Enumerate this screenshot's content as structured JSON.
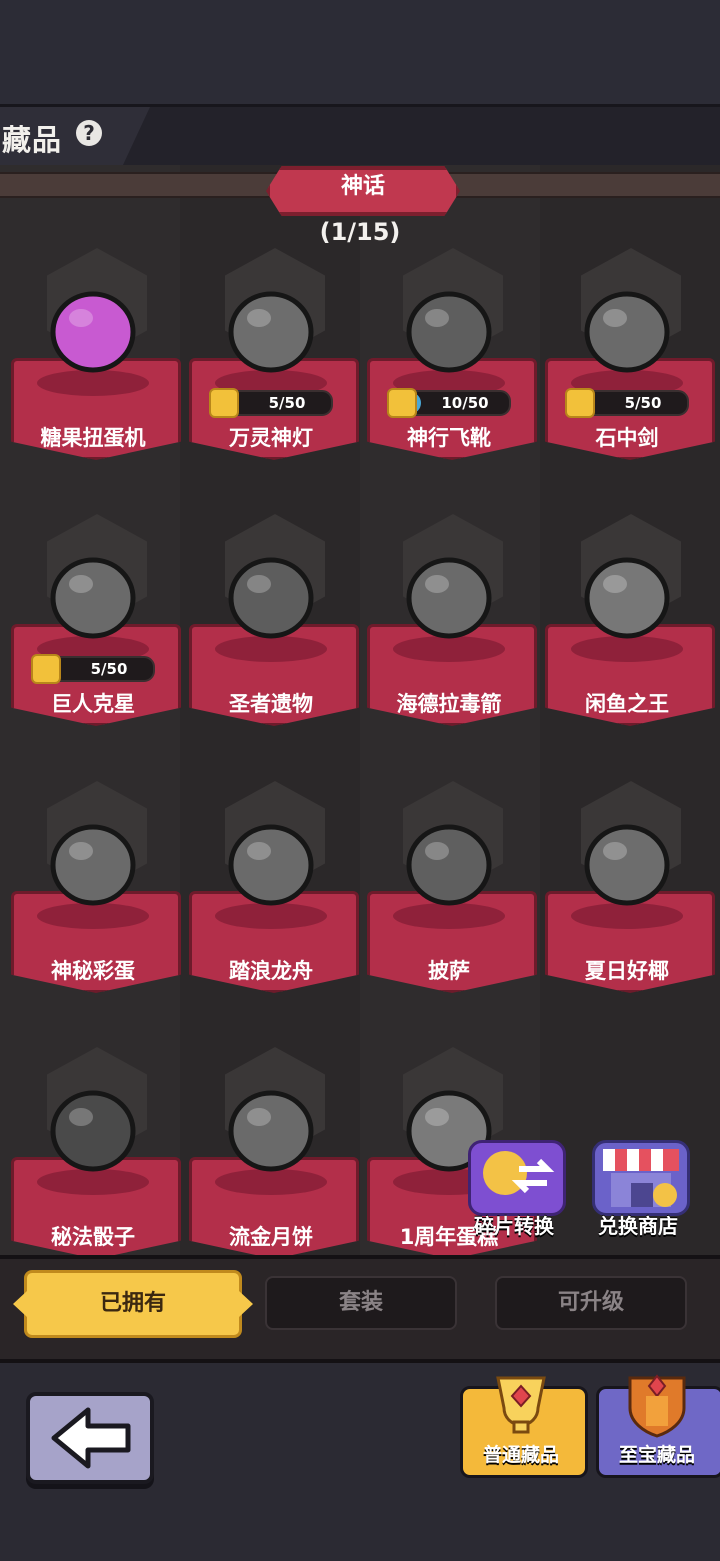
{
  "header": {
    "title": "藏品",
    "help_label": "?"
  },
  "category": {
    "name": "神话",
    "count": "(1/15)"
  },
  "items": [
    {
      "name": "糖果扭蛋机",
      "owned": true,
      "progress": null,
      "progress_fraction": null
    },
    {
      "name": "万灵神灯",
      "owned": false,
      "progress": "5/50",
      "progress_fraction": 0.1
    },
    {
      "name": "神行飞靴",
      "owned": false,
      "progress": "10/50",
      "progress_fraction": 0.2
    },
    {
      "name": "石中剑",
      "owned": false,
      "progress": "5/50",
      "progress_fraction": 0.1
    },
    {
      "name": "巨人克星",
      "owned": false,
      "progress": "5/50",
      "progress_fraction": 0.1
    },
    {
      "name": "圣者遗物",
      "owned": false,
      "progress": null,
      "progress_fraction": null
    },
    {
      "name": "海德拉毒箭",
      "owned": false,
      "progress": null,
      "progress_fraction": null
    },
    {
      "name": "闲鱼之王",
      "owned": false,
      "progress": null,
      "progress_fraction": null
    },
    {
      "name": "神秘彩蛋",
      "owned": false,
      "progress": null,
      "progress_fraction": null
    },
    {
      "name": "踏浪龙舟",
      "owned": false,
      "progress": null,
      "progress_fraction": null
    },
    {
      "name": "披萨",
      "owned": false,
      "progress": null,
      "progress_fraction": null
    },
    {
      "name": "夏日好椰",
      "owned": false,
      "progress": null,
      "progress_fraction": null
    },
    {
      "name": "秘法骰子",
      "owned": false,
      "progress": null,
      "progress_fraction": null
    },
    {
      "name": "流金月饼",
      "owned": false,
      "progress": null,
      "progress_fraction": null
    },
    {
      "name": "1周年蛋糕",
      "owned": false,
      "progress": null,
      "progress_fraction": null
    }
  ],
  "floating_buttons": {
    "convert": "碎片转换",
    "shop": "兑换商店"
  },
  "filters": {
    "owned": "已拥有",
    "set": "套装",
    "upgradable": "可升级"
  },
  "nav": {
    "normal": "普通藏品",
    "treasure": "至宝藏品"
  },
  "colors": {
    "accent": "#f6c84a",
    "banner": "#b32f4a",
    "progress": "#4aa8d6"
  },
  "icons": {
    "help": "question-circle-icon",
    "back": "arrow-left-icon",
    "puzzle": "puzzle-piece-icon",
    "convert": "fragment-convert-icon",
    "shop": "shop-stall-icon",
    "normal": "trophy-cup-icon",
    "treasure": "treasure-shield-icon"
  }
}
